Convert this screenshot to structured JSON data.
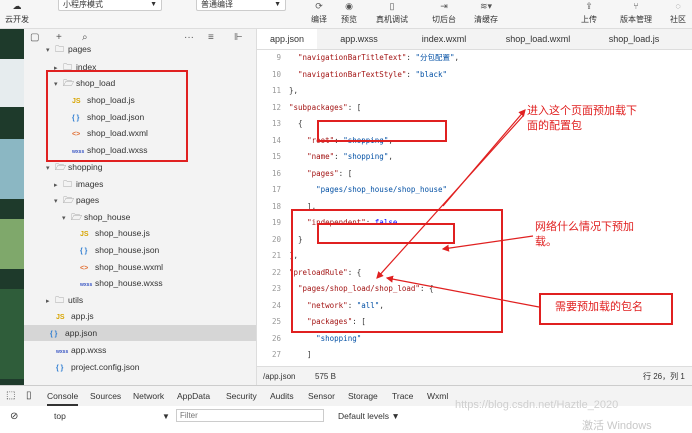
{
  "toolbar": {
    "cloud_label": "云开发",
    "mode_select": "小程序模式",
    "compile_select": "普通编译",
    "buttons": [
      {
        "label": "编译",
        "icon": "refresh-icon"
      },
      {
        "label": "预览",
        "icon": "eye-icon"
      },
      {
        "label": "真机调试",
        "icon": "phone-icon"
      },
      {
        "label": "切后台",
        "icon": "switch-icon"
      },
      {
        "label": "清缓存",
        "icon": "layers-icon"
      }
    ],
    "right_buttons": [
      {
        "label": "上传",
        "icon": "upload-icon"
      },
      {
        "label": "版本管理",
        "icon": "version-icon"
      },
      {
        "label": "社区",
        "icon": "chat-icon"
      }
    ]
  },
  "tree": {
    "items": [
      {
        "name": "pages",
        "type": "folder",
        "arrow": "▾"
      },
      {
        "name": "index",
        "type": "folder",
        "arrow": "▸"
      },
      {
        "name": "shop_load",
        "type": "folder",
        "arrow": "▾"
      },
      {
        "name": "shop_load.js",
        "type": "js",
        "badge": "JS"
      },
      {
        "name": "shop_load.json",
        "type": "json",
        "badge": "{ }"
      },
      {
        "name": "shop_load.wxml",
        "type": "wxml",
        "badge": "<>"
      },
      {
        "name": "shop_load.wxss",
        "type": "wxss",
        "badge": "wxss"
      },
      {
        "name": "shopping",
        "type": "folder",
        "arrow": "▾"
      },
      {
        "name": "images",
        "type": "folder",
        "arrow": "▸"
      },
      {
        "name": "pages",
        "type": "folder",
        "arrow": "▾"
      },
      {
        "name": "shop_house",
        "type": "folder",
        "arrow": "▾"
      },
      {
        "name": "shop_house.js",
        "type": "js",
        "badge": "JS"
      },
      {
        "name": "shop_house.json",
        "type": "json",
        "badge": "{ }"
      },
      {
        "name": "shop_house.wxml",
        "type": "wxml",
        "badge": "<>"
      },
      {
        "name": "shop_house.wxss",
        "type": "wxss",
        "badge": "wxss"
      },
      {
        "name": "utils",
        "type": "folder",
        "arrow": "▸"
      },
      {
        "name": "app.js",
        "type": "js",
        "badge": "JS"
      },
      {
        "name": "app.json",
        "type": "json",
        "badge": "{ }"
      },
      {
        "name": "app.wxss",
        "type": "wxss",
        "badge": "wxss"
      },
      {
        "name": "project.config.json",
        "type": "json",
        "badge": "{ }"
      }
    ]
  },
  "tabs": [
    "app.json",
    "app.wxss",
    "index.wxml",
    "shop_load.wxml",
    "shop_load.js"
  ],
  "code_lines": [
    {
      "n": "9",
      "t": "  \"navigationBarTitleText\": \"分包配置\","
    },
    {
      "n": "10",
      "t": "  \"navigationBarTextStyle\": \"black\""
    },
    {
      "n": "11",
      "t": "},"
    },
    {
      "n": "12",
      "t": "\"subpackages\": ["
    },
    {
      "n": "13",
      "t": "  {"
    },
    {
      "n": "14",
      "t": "    \"root\": \"shopping\","
    },
    {
      "n": "15",
      "t": "    \"name\": \"shopping\","
    },
    {
      "n": "16",
      "t": "    \"pages\": ["
    },
    {
      "n": "17",
      "t": "      \"pages/shop_house/shop_house\""
    },
    {
      "n": "18",
      "t": "    ],"
    },
    {
      "n": "19",
      "t": "    \"independent\": false"
    },
    {
      "n": "20",
      "t": "  }"
    },
    {
      "n": "21",
      "t": "],"
    },
    {
      "n": "22",
      "t": "\"preloadRule\": {"
    },
    {
      "n": "23",
      "t": "  \"pages/shop_load/shop_load\": {"
    },
    {
      "n": "24",
      "t": "    \"network\": \"all\","
    },
    {
      "n": "25",
      "t": "    \"packages\": ["
    },
    {
      "n": "26",
      "t": "      \"shopping\""
    },
    {
      "n": "27",
      "t": "    ]"
    },
    {
      "n": "28",
      "t": "  }"
    },
    {
      "n": "29",
      "t": "}"
    },
    {
      "n": "30",
      "t": "}"
    }
  ],
  "annotations": {
    "note1": "进入这个页面预加载下面的配置包",
    "note2": "网络什么情况下预加载。",
    "note3": "需要预加载的包名"
  },
  "status": {
    "path": "/app.json",
    "size": "575 B",
    "position": "行 26，列 1"
  },
  "devtools": {
    "tabs": [
      "Console",
      "Sources",
      "Network",
      "AppData",
      "Security",
      "Audits",
      "Sensor",
      "Storage",
      "Trace",
      "Wxml"
    ],
    "context": "top",
    "filter_placeholder": "Filter",
    "levels": "Default levels ▼"
  },
  "watermark": "https://blog.csdn.net/Haztle_2020",
  "winmark": "激活 Windows"
}
